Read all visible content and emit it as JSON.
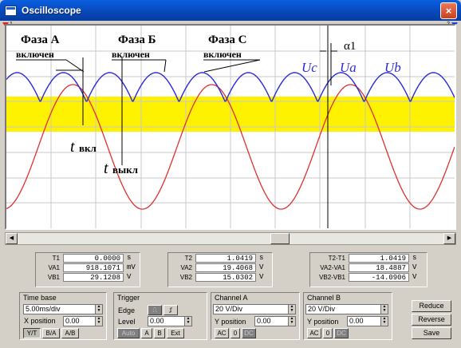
{
  "window": {
    "title": "Oscilloscope",
    "close_glyph": "×"
  },
  "screen": {
    "background_band_color": "#fff200",
    "trace_a_color": "#2b2bd6",
    "trace_b_color": "#e03030",
    "cursor_labels": {
      "left": "1",
      "right": "2"
    },
    "annotations": {
      "phase_a": "Фаза А",
      "phase_a_on": "включен",
      "phase_b": "Фаза Б",
      "phase_b_on": "включен",
      "phase_c": "Фаза С",
      "phase_c_on": "включен",
      "alpha": "α1",
      "uc": "Uc",
      "ua": "Ua",
      "ub": "Ub",
      "t_on_main": "t",
      "t_on_sub": "вкл",
      "t_off_main": "t",
      "t_off_sub": "выкл"
    }
  },
  "readouts": {
    "cursor1": [
      {
        "label": "T1",
        "value": "0.0000",
        "unit": "s"
      },
      {
        "label": "VA1",
        "value": "918.1071",
        "unit": "mV"
      },
      {
        "label": "VB1",
        "value": "29.1208",
        "unit": "V"
      }
    ],
    "cursor2": [
      {
        "label": "T2",
        "value": "1.0419",
        "unit": "s"
      },
      {
        "label": "VA2",
        "value": "19.4068",
        "unit": "V"
      },
      {
        "label": "VB2",
        "value": "15.0302",
        "unit": "V"
      }
    ],
    "diff": [
      {
        "label": "T2-T1",
        "value": "1.0419",
        "unit": "s"
      },
      {
        "label": "VA2-VA1",
        "value": "18.4887",
        "unit": "V"
      },
      {
        "label": "VB2-VB1",
        "value": "-14.0906",
        "unit": "V"
      }
    ]
  },
  "controls": {
    "timebase": {
      "title": "Time base",
      "scale": "5.00ms/div",
      "xpos_label": "X position",
      "xpos_value": "0.00",
      "modes": [
        "Y/T",
        "B/A",
        "A/B"
      ]
    },
    "trigger": {
      "title": "Trigger",
      "edge_label": "Edge",
      "level_label": "Level",
      "level_value": "0.00",
      "sources": [
        "Auto",
        "A",
        "B",
        "Ext"
      ]
    },
    "channel_a": {
      "title": "Channel A",
      "scale": "20 V/Div",
      "ypos_label": "Y position",
      "ypos_value": "0.00",
      "coupling": [
        "AC",
        "0",
        "DC"
      ]
    },
    "channel_b": {
      "title": "Channel B",
      "scale": "20 V/Div",
      "ypos_label": "Y position",
      "ypos_value": "0.00",
      "coupling": [
        "AC",
        "0",
        "DC"
      ]
    },
    "actions": [
      "Reduce",
      "Reverse",
      "Save"
    ]
  }
}
